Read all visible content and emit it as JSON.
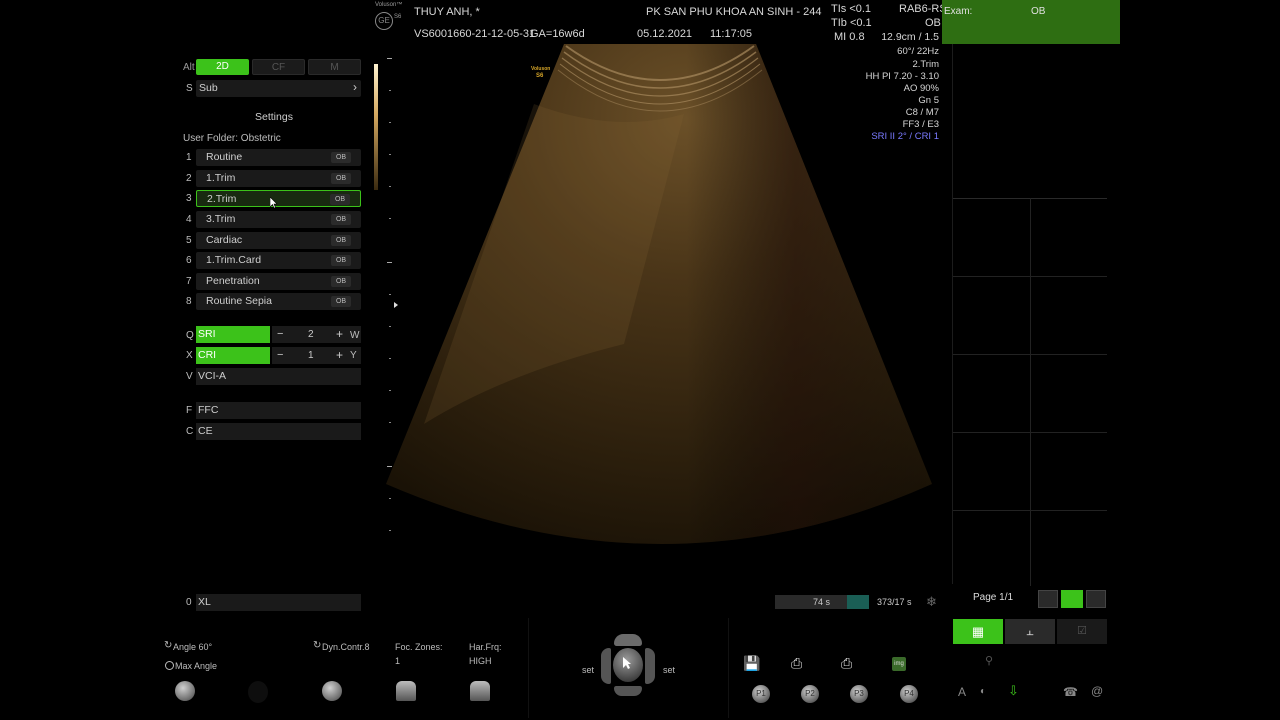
{
  "header": {
    "brand": "Voluson™",
    "model": "S6",
    "patient": "THUY ANH,  *",
    "clinic": "PK SAN PHU KHOA AN SINH - 244",
    "exam_id": "VS6001660-21-12-05-31",
    "ga": "GA=16w6d",
    "date": "05.12.2021",
    "time": "11:17:05",
    "tis": "TIs <0.1",
    "tib": "TIb <0.1",
    "mi": "MI  0.8",
    "probe": "RAB6-RS",
    "probe_app": "OB",
    "exam_label": "Exam:",
    "exam_value": "OB"
  },
  "image_overlay": {
    "logo": "Voluson",
    "logo_model": "S6"
  },
  "image_params": [
    "12.9cm / 1.5",
    "60°/ 22Hz",
    "2.Trim",
    "HH PI 7.20 - 3.10",
    "AO 90%",
    "Gn  5",
    "C8 / M7",
    "FF3 / E3"
  ],
  "image_params_highlight": "SRI II 2° / CRI 1",
  "left_panel": {
    "alt_key": "Alt",
    "modes": [
      "2D",
      "CF",
      "M"
    ],
    "sub_key": "S",
    "sub_label": "Sub",
    "sub_arrow": "›",
    "settings_title": "Settings",
    "user_folder": "User Folder: Obstetric",
    "presets": [
      {
        "num": "1",
        "label": "Routine",
        "tag": "OB"
      },
      {
        "num": "2",
        "label": "1.Trim",
        "tag": "OB"
      },
      {
        "num": "3",
        "label": "2.Trim",
        "tag": "OB"
      },
      {
        "num": "4",
        "label": "3.Trim",
        "tag": "OB"
      },
      {
        "num": "5",
        "label": "Cardiac",
        "tag": "OB"
      },
      {
        "num": "6",
        "label": "1.Trim.Card",
        "tag": "OB"
      },
      {
        "num": "7",
        "label": "Penetration",
        "tag": "OB"
      },
      {
        "num": "8",
        "label": "Routine Sepia",
        "tag": "OB"
      }
    ],
    "sri": {
      "key": "Q",
      "label": "SRI",
      "minus": "−",
      "value": "2",
      "plus": "+",
      "key2": "W"
    },
    "cri": {
      "key": "X",
      "label": "CRI",
      "minus": "−",
      "value": "1",
      "plus": "+",
      "key2": "Y"
    },
    "vci": {
      "key": "V",
      "label": "VCI-A"
    },
    "ffc": {
      "key": "F",
      "label": "FFC"
    },
    "ce": {
      "key": "C",
      "label": "CE"
    },
    "xl": {
      "key": "0",
      "label": "XL"
    }
  },
  "cine": {
    "duration": "74 s",
    "frames": "373/17 s"
  },
  "right_panel": {
    "page": "Page 1/1"
  },
  "bottom": {
    "angle": "Angle 60°",
    "max_angle": "Max Angle",
    "dyn_contr": "Dyn.Contr.8",
    "foc_zones_label": "Foc. Zones:",
    "foc_zones_value": "1",
    "har_frq_label": "Har.Frq:",
    "har_frq_value": "HIGH",
    "set_left": "set",
    "set_right": "set",
    "p_buttons": [
      "P1",
      "P2",
      "P3",
      "P4"
    ],
    "save_icon_label": "img"
  }
}
